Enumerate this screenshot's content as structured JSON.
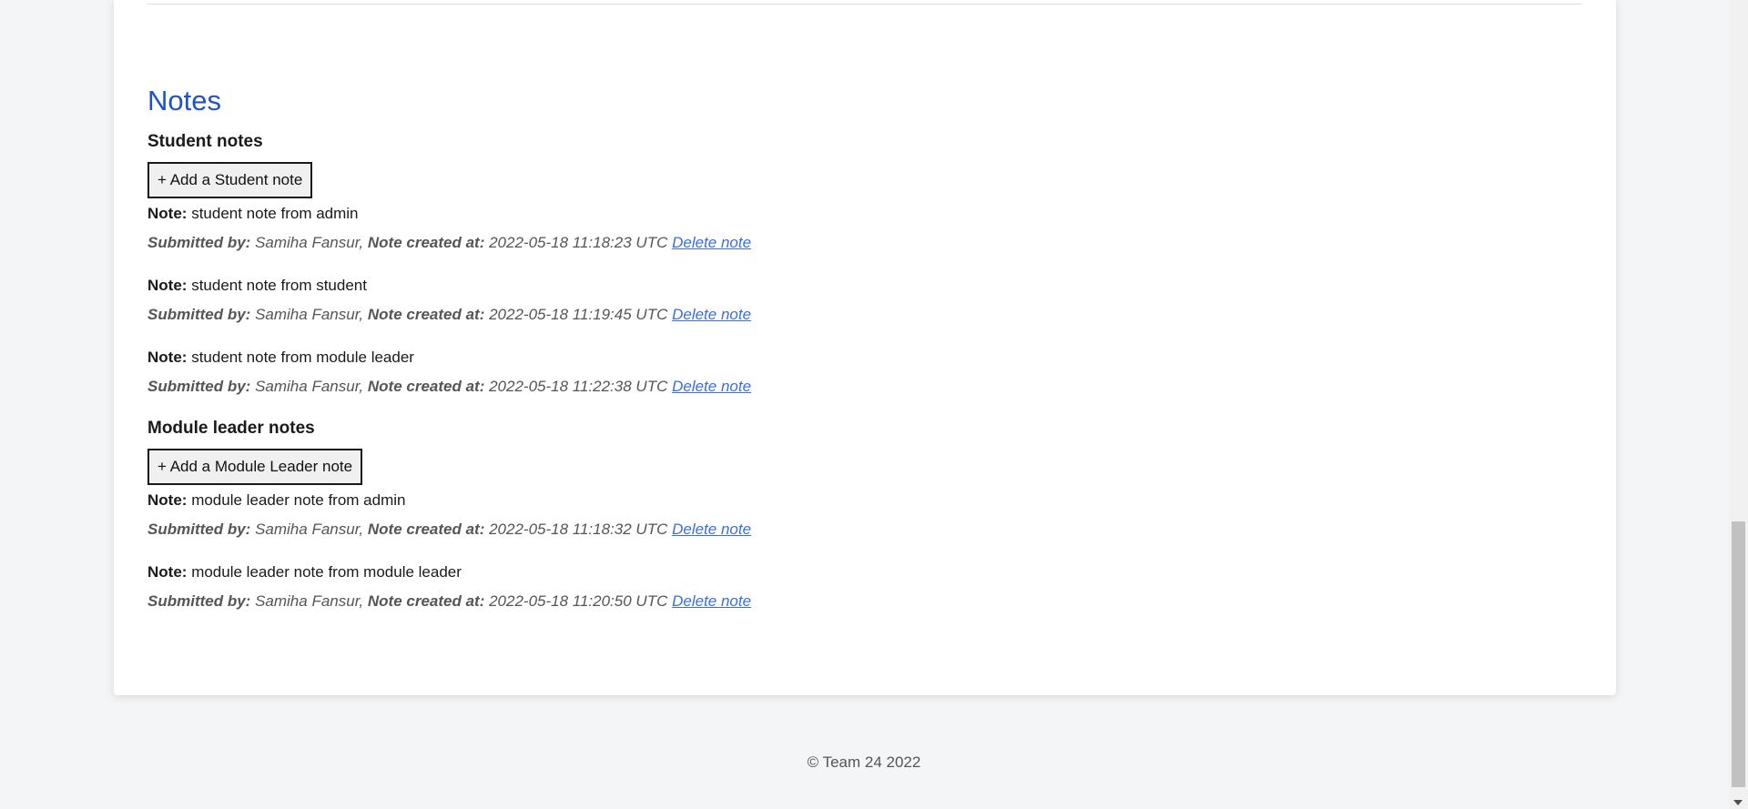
{
  "notes_section": {
    "title": "Notes"
  },
  "student_notes": {
    "heading": "Student notes",
    "add_button": "+ Add a Student note",
    "items": [
      {
        "note_label": "Note:",
        "text": "student note from admin",
        "submitted_label": "Submitted by:",
        "author": "Samiha Fansur,",
        "created_label": "Note created at:",
        "created_at": "2022-05-18 11:18:23 UTC",
        "delete_label": "Delete note"
      },
      {
        "note_label": "Note:",
        "text": "student note from student",
        "submitted_label": "Submitted by:",
        "author": "Samiha Fansur,",
        "created_label": "Note created at:",
        "created_at": "2022-05-18 11:19:45 UTC",
        "delete_label": "Delete note"
      },
      {
        "note_label": "Note:",
        "text": "student note from module leader",
        "submitted_label": "Submitted by:",
        "author": "Samiha Fansur,",
        "created_label": "Note created at:",
        "created_at": "2022-05-18 11:22:38 UTC",
        "delete_label": "Delete note"
      }
    ]
  },
  "module_leader_notes": {
    "heading": "Module leader notes",
    "add_button": "+ Add a Module Leader note",
    "items": [
      {
        "note_label": "Note:",
        "text": "module leader note from admin",
        "submitted_label": "Submitted by:",
        "author": "Samiha Fansur,",
        "created_label": "Note created at:",
        "created_at": "2022-05-18 11:18:32 UTC",
        "delete_label": "Delete note"
      },
      {
        "note_label": "Note:",
        "text": "module leader note from module leader",
        "submitted_label": "Submitted by:",
        "author": "Samiha Fansur,",
        "created_label": "Note created at:",
        "created_at": "2022-05-18 11:20:50 UTC",
        "delete_label": "Delete note"
      }
    ]
  },
  "footer": {
    "copyright": "© Team 24 2022"
  },
  "colors": {
    "accent": "#1e54c8",
    "link": "#3a6fd8",
    "background": "#f4f5f7",
    "card": "#ffffff"
  }
}
